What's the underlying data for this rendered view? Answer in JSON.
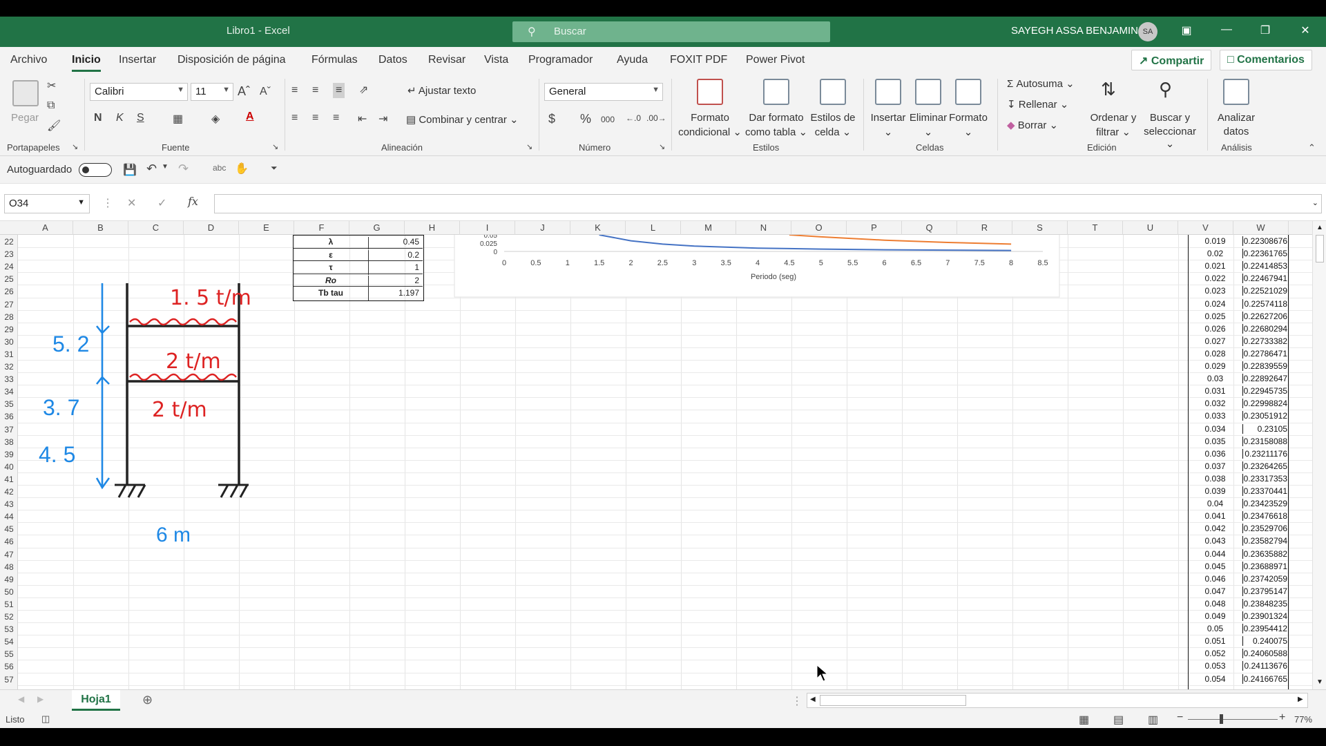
{
  "title": {
    "workbook": "Libro1",
    "sep": " -  ",
    "app": "Excel"
  },
  "search": {
    "placeholder": "Buscar"
  },
  "user": {
    "name": "SAYEGH ASSA BENJAMIN",
    "initials": "SA"
  },
  "menu": [
    "Archivo",
    "Inicio",
    "Insertar",
    "Disposición de página",
    "Fórmulas",
    "Datos",
    "Revisar",
    "Vista",
    "Programador",
    "Ayuda",
    "FOXIT PDF",
    "Power Pivot"
  ],
  "actions": {
    "share": "Compartir",
    "comments": "Comentarios"
  },
  "ribbon": {
    "clipboard": {
      "paste": "Pegar",
      "label": "Portapapeles"
    },
    "font": {
      "name": "Calibri",
      "size": "11",
      "bold": "N",
      "italic": "K",
      "underline": "S",
      "label": "Fuente"
    },
    "alignment": {
      "wrap": "Ajustar texto",
      "merge": "Combinar y centrar",
      "label": "Alineación"
    },
    "number": {
      "format": "General",
      "label": "Número"
    },
    "styles": {
      "cond1": "Formato",
      "cond2": "condicional",
      "table1": "Dar formato",
      "table2": "como tabla",
      "cell1": "Estilos de",
      "cell2": "celda",
      "label": "Estilos"
    },
    "cells": {
      "insert": "Insertar",
      "delete": "Eliminar",
      "format": "Formato",
      "label": "Celdas"
    },
    "editing": {
      "autosum": "Autosuma",
      "fill": "Rellenar",
      "clear": "Borrar",
      "sort1": "Ordenar y",
      "sort2": "filtrar",
      "find1": "Buscar y",
      "find2": "seleccionar",
      "label": "Edición"
    },
    "analysis": {
      "a1": "Analizar",
      "a2": "datos",
      "label": "Análisis"
    }
  },
  "qat": {
    "autosave": "Autoguardado"
  },
  "formula_bar": {
    "name_box": "O34",
    "fx": "fx"
  },
  "columns": [
    "A",
    "B",
    "C",
    "D",
    "E",
    "F",
    "G",
    "H",
    "I",
    "J",
    "K",
    "L",
    "M",
    "N",
    "O",
    "P",
    "Q",
    "R",
    "S",
    "T",
    "U",
    "V",
    "W"
  ],
  "rows": [
    "22",
    "23",
    "24",
    "25",
    "26",
    "27",
    "28",
    "29",
    "30",
    "31",
    "32",
    "33",
    "34",
    "35",
    "36",
    "37",
    "38",
    "39",
    "40",
    "41",
    "42",
    "43",
    "44",
    "45",
    "46",
    "47",
    "48",
    "49",
    "50",
    "51",
    "52",
    "53",
    "54",
    "55",
    "56",
    "57"
  ],
  "param_table": [
    {
      "label": "λ",
      "value": "0.45"
    },
    {
      "label": "ε",
      "value": "0.2"
    },
    {
      "label": "τ",
      "value": "1"
    },
    {
      "label": "Ro",
      "value": "2"
    },
    {
      "label": "Tb tau",
      "value": "1.197"
    }
  ],
  "chart_data": {
    "type": "line",
    "xlabel": "Periodo (seg)",
    "x_ticks": [
      "0",
      "0.5",
      "1",
      "1.5",
      "2",
      "2.5",
      "3",
      "3.5",
      "4",
      "4.5",
      "5",
      "5.5",
      "6",
      "6.5",
      "7",
      "7.5",
      "8",
      "8.5"
    ],
    "y_ticks": [
      "0.05",
      "0.025",
      "0"
    ],
    "xlim": [
      0,
      8.5
    ],
    "ylim_visible": [
      0,
      0.05
    ],
    "series": [
      {
        "color": "#4472c4",
        "x": [
          1.5,
          2,
          2.5,
          3,
          4,
          5,
          6,
          7,
          8
        ],
        "y": [
          0.05,
          0.032,
          0.022,
          0.016,
          0.01,
          0.007,
          0.005,
          0.004,
          0.003
        ]
      },
      {
        "color": "#ed7d31",
        "x": [
          4.5,
          5,
          6,
          7,
          8
        ],
        "y": [
          0.05,
          0.044,
          0.034,
          0.027,
          0.022
        ]
      }
    ]
  },
  "col_V": [
    "0.019",
    "0.02",
    "0.021",
    "0.022",
    "0.023",
    "0.024",
    "0.025",
    "0.026",
    "0.027",
    "0.028",
    "0.029",
    "0.03",
    "0.031",
    "0.032",
    "0.033",
    "0.034",
    "0.035",
    "0.036",
    "0.037",
    "0.038",
    "0.039",
    "0.04",
    "0.041",
    "0.042",
    "0.043",
    "0.044",
    "0.045",
    "0.046",
    "0.047",
    "0.048",
    "0.049",
    "0.05",
    "0.051",
    "0.052",
    "0.053",
    "0.054"
  ],
  "col_W": [
    "0.22308676",
    "0.22361765",
    "0.22414853",
    "0.22467941",
    "0.22521029",
    "0.22574118",
    "0.22627206",
    "0.22680294",
    "0.22733382",
    "0.22786471",
    "0.22839559",
    "0.22892647",
    "0.22945735",
    "0.22998824",
    "0.23051912",
    "0.23105",
    "0.23158088",
    "0.23211176",
    "0.23264265",
    "0.23317353",
    "0.23370441",
    "0.23423529",
    "0.23476618",
    "0.23529706",
    "0.23582794",
    "0.23635882",
    "0.23688971",
    "0.23742059",
    "0.23795147",
    "0.23848235",
    "0.23901324",
    "0.23954412",
    "0.240075",
    "0.24060588",
    "0.24113676",
    "0.24166765"
  ],
  "sketch": {
    "load_top": "1. 5 t/m",
    "load_mid": "2 t/m",
    "load_low": "2 t/m",
    "h1": "5. 2",
    "h2": "3. 7",
    "h3": "4. 5",
    "span": "6 m"
  },
  "sheet_tab": "Hoja1",
  "status": {
    "ready": "Listo",
    "zoom": "77%"
  }
}
